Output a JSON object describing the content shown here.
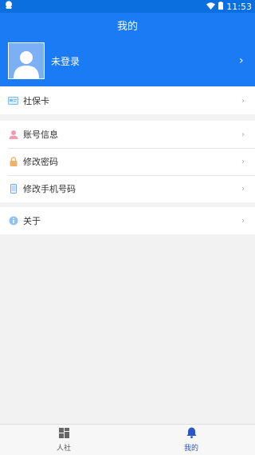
{
  "status": {
    "time": "11:53",
    "app_icon": "notification-app-icon",
    "wifi_icon": "wifi-icon",
    "battery_icon": "battery-icon"
  },
  "header": {
    "title": "我的"
  },
  "profile": {
    "name": "未登录",
    "avatar_icon": "avatar-placeholder-icon"
  },
  "menu": {
    "card": {
      "label": "社保卡",
      "icon": "card-icon"
    },
    "account": [
      {
        "label": "账号信息",
        "icon": "user-icon"
      },
      {
        "label": "修改密码",
        "icon": "lock-icon"
      },
      {
        "label": "修改手机号码",
        "icon": "phone-icon"
      }
    ],
    "about": {
      "label": "关于",
      "icon": "info-icon"
    }
  },
  "tabs": [
    {
      "label": "人社",
      "icon": "grid-icon",
      "active": false
    },
    {
      "label": "我的",
      "icon": "bell-icon",
      "active": true
    }
  ],
  "colors": {
    "primary": "#1a7bf5",
    "statusbar": "#0b6fe0",
    "tab_active": "#2a56c6"
  }
}
